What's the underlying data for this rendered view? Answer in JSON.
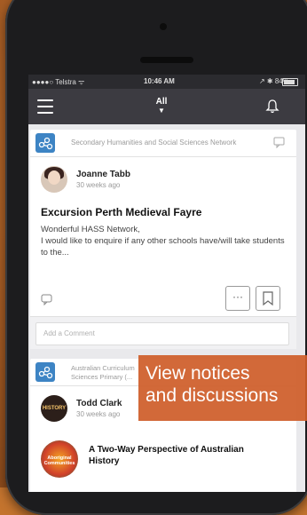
{
  "status_bar": {
    "carrier": "●●●●○ Telstra ᯤ",
    "time": "10:46 AM",
    "battery": "↗ ✱ 84%"
  },
  "app_bar": {
    "filter_label": "All",
    "menu_icon": "hamburger-icon",
    "bell_icon": "bell-icon"
  },
  "posts": [
    {
      "network": "Secondary Humanities and Social Sciences Network",
      "author": "Joanne Tabb",
      "time": "30 weeks ago",
      "title": "Excursion Perth Medieval Fayre",
      "body_line1": "Wonderful HASS Network,",
      "body_line2": "I would like to enquire if any other schools have/will take students to the...",
      "more_label": "···",
      "comment_placeholder": "Add a Comment"
    },
    {
      "network": "Australian Curriculum Sciences Primary (...",
      "author": "Todd Clark",
      "time": "30 weeks ago",
      "avatar_text": "HISTORY",
      "thumb_text": "Aboriginal Communities",
      "article_title": "A Two-Way Perspective of Australian History"
    }
  ],
  "overlay": {
    "line1": "View notices",
    "line2": "and discussions"
  },
  "colors": {
    "app_bar": "#3c3b41",
    "network_icon": "#3d84c4",
    "overlay": "#ce5c28",
    "background": "#c4742e"
  }
}
